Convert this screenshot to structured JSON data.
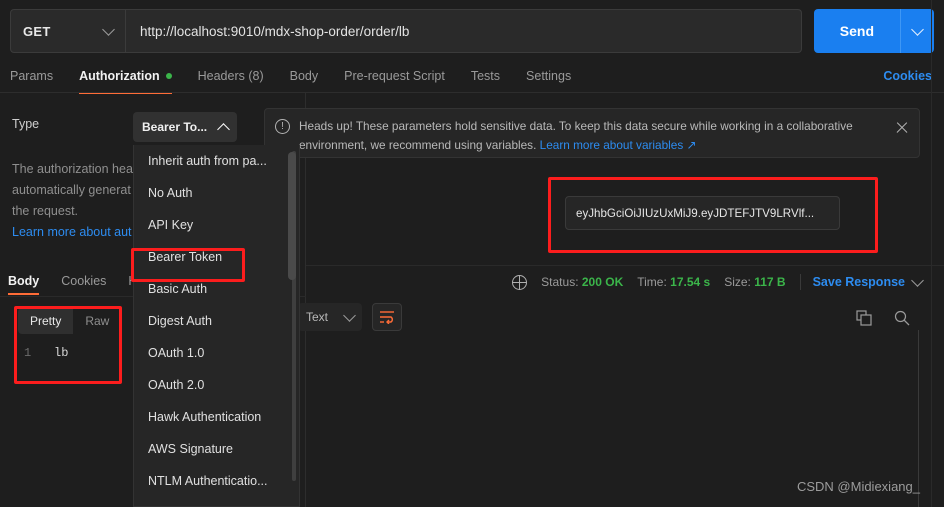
{
  "request": {
    "method": "GET",
    "url": "http://localhost:9010/mdx-shop-order/order/lb",
    "send_label": "Send"
  },
  "tabs": [
    {
      "label": "Params",
      "active": false
    },
    {
      "label": "Authorization",
      "active": true,
      "dot": true
    },
    {
      "label": "Headers (8)",
      "active": false
    },
    {
      "label": "Body",
      "active": false
    },
    {
      "label": "Pre-request Script",
      "active": false
    },
    {
      "label": "Tests",
      "active": false
    },
    {
      "label": "Settings",
      "active": false
    }
  ],
  "cookies_link": "Cookies",
  "auth": {
    "type_label": "Type",
    "selected_type": "Bearer To...",
    "description": "The authorization hea",
    "description_line2": "automatically generat",
    "description_line3": "the request.",
    "learn_more": "Learn more about aut",
    "options": [
      "Inherit auth from pa...",
      "No Auth",
      "API Key",
      "Bearer Token",
      "Basic Auth",
      "Digest Auth",
      "OAuth 1.0",
      "OAuth 2.0",
      "Hawk Authentication",
      "AWS Signature",
      "NTLM Authenticatio..."
    ],
    "token_value": "eyJhbGciOiJIUzUxMiJ9.eyJDTEFJTV9LRVlf..."
  },
  "banner": {
    "text": "Heads up! These parameters hold sensitive data. To keep this data secure while working in a collaborative environment, we recommend using variables. ",
    "link": "Learn more about variables ↗"
  },
  "response": {
    "tabs": [
      {
        "label": "Body",
        "active": true
      },
      {
        "label": "Cookies",
        "active": false
      },
      {
        "label": "He",
        "active": false
      }
    ],
    "view_modes": [
      {
        "label": "Pretty",
        "active": true
      },
      {
        "label": "Raw",
        "active": false
      }
    ],
    "format": "Text",
    "line_number": "1",
    "body": "lb",
    "status_label": "Status:",
    "status_value": "200 OK",
    "time_label": "Time:",
    "time_value": "17.54 s",
    "size_label": "Size:",
    "size_value": "117 B",
    "save_response": "Save Response"
  },
  "watermark": "CSDN @Midiexiang_",
  "colors": {
    "accent_orange": "#ff6c37",
    "send_blue": "#1a7ff0",
    "link_blue": "#2d8cf0",
    "success_green": "#3bb54a",
    "highlight_red": "#fc1d1d",
    "background": "#1e1e1e"
  }
}
